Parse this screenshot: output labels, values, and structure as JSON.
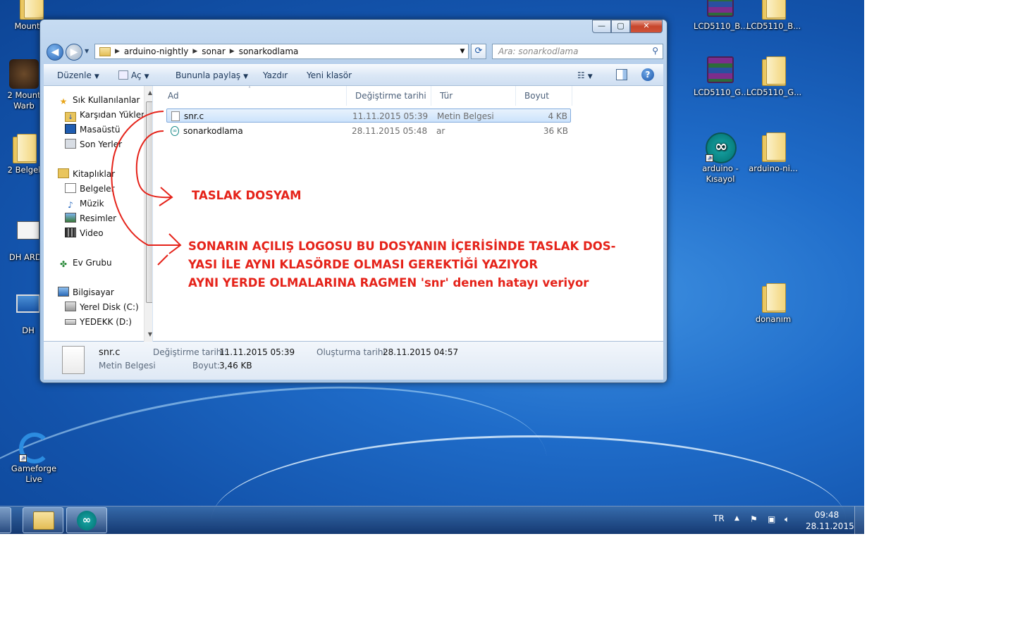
{
  "window": {
    "breadcrumbs": [
      "arduino-nightly",
      "sonar",
      "sonarkodlama"
    ],
    "search_placeholder": "Ara: sonarkodlama",
    "caption_buttons": {
      "minimize": "—",
      "maximize": "▢",
      "close": "✕"
    },
    "toolbar": {
      "organize": "Düzenle",
      "open": "Aç",
      "share": "Bununla paylaş",
      "print": "Yazdır",
      "new_folder": "Yeni klasör"
    },
    "nav_pane": {
      "favorites": {
        "label": "Sık Kullanılanlar",
        "items": [
          "Karşıdan Yüklen",
          "Masaüstü",
          "Son Yerler"
        ]
      },
      "libraries": {
        "label": "Kitaplıklar",
        "items": [
          "Belgeler",
          "Müzik",
          "Resimler",
          "Video"
        ]
      },
      "homegroup": "Ev Grubu",
      "computer": {
        "label": "Bilgisayar",
        "items": [
          "Yerel Disk (C:)",
          "YEDEKK (D:)"
        ]
      }
    },
    "columns": {
      "name": "Ad",
      "modified": "Değiştirme tarihi",
      "type": "Tür",
      "size": "Boyut"
    },
    "files": [
      {
        "name": "snr.c",
        "modified": "11.11.2015 05:39",
        "type": "Metin Belgesi",
        "size": "4 KB",
        "selected": true
      },
      {
        "name": "sonarkodlama",
        "modified": "28.11.2015 05:48",
        "type": "ar",
        "size": "36 KB",
        "selected": false
      }
    ],
    "details": {
      "name": "snr.c",
      "type": "Metin Belgesi",
      "modified_label": "Değiştirme tarihi:",
      "modified_value": "11.11.2015 05:39",
      "created_label": "Oluşturma tarihi:",
      "created_value": "28.11.2015 04:57",
      "size_label": "Boyut:",
      "size_value": "3,46 KB"
    }
  },
  "desktop_icons_left": [
    {
      "label": "Mount ..",
      "icon": "folder-icon"
    },
    {
      "label": "2  Mount Warb",
      "icon": "warband-icon"
    },
    {
      "label": "2  Belgel",
      "icon": "folder-icon"
    },
    {
      "label": "DH ARDU",
      "icon": "document-icon"
    },
    {
      "label": "DH",
      "icon": "monitor-icon"
    },
    {
      "label": "Gameforge Live",
      "icon": "gameforge-icon"
    }
  ],
  "desktop_icons_right": [
    {
      "label": "LCD5110_B...",
      "icon": "winrar-icon"
    },
    {
      "label": "LCD5110_B...",
      "icon": "folder-icon"
    },
    {
      "label": "LCD5110_G...",
      "icon": "winrar-icon"
    },
    {
      "label": "LCD5110_G...",
      "icon": "folder-icon"
    },
    {
      "label": "arduino - Kısayol",
      "icon": "arduino-icon"
    },
    {
      "label": "arduino-ni...",
      "icon": "folder-icon"
    },
    {
      "label": "donanım",
      "icon": "folder-icon"
    }
  ],
  "annotations": {
    "label1": "TASLAK DOSYAM",
    "line1": "SONARIN AÇILIŞ LOGOSU BU DOSYANIN İÇERİSİNDE TASLAK DOS-",
    "line2": "YASI İLE AYNI KLASÖRDE OLMASI GEREKTİĞİ YAZIYOR",
    "line3": "AYNI YERDE OLMALARINA RAGMEN 'snr' denen hatayı veriyor",
    "color": "#e5231a"
  },
  "taskbar": {
    "language": "TR",
    "time": "09:48",
    "date": "28.11.2015"
  },
  "colors": {
    "desktop": "#1f6cc9",
    "selection": "#cce3fb",
    "annotation": "#e5231a"
  }
}
